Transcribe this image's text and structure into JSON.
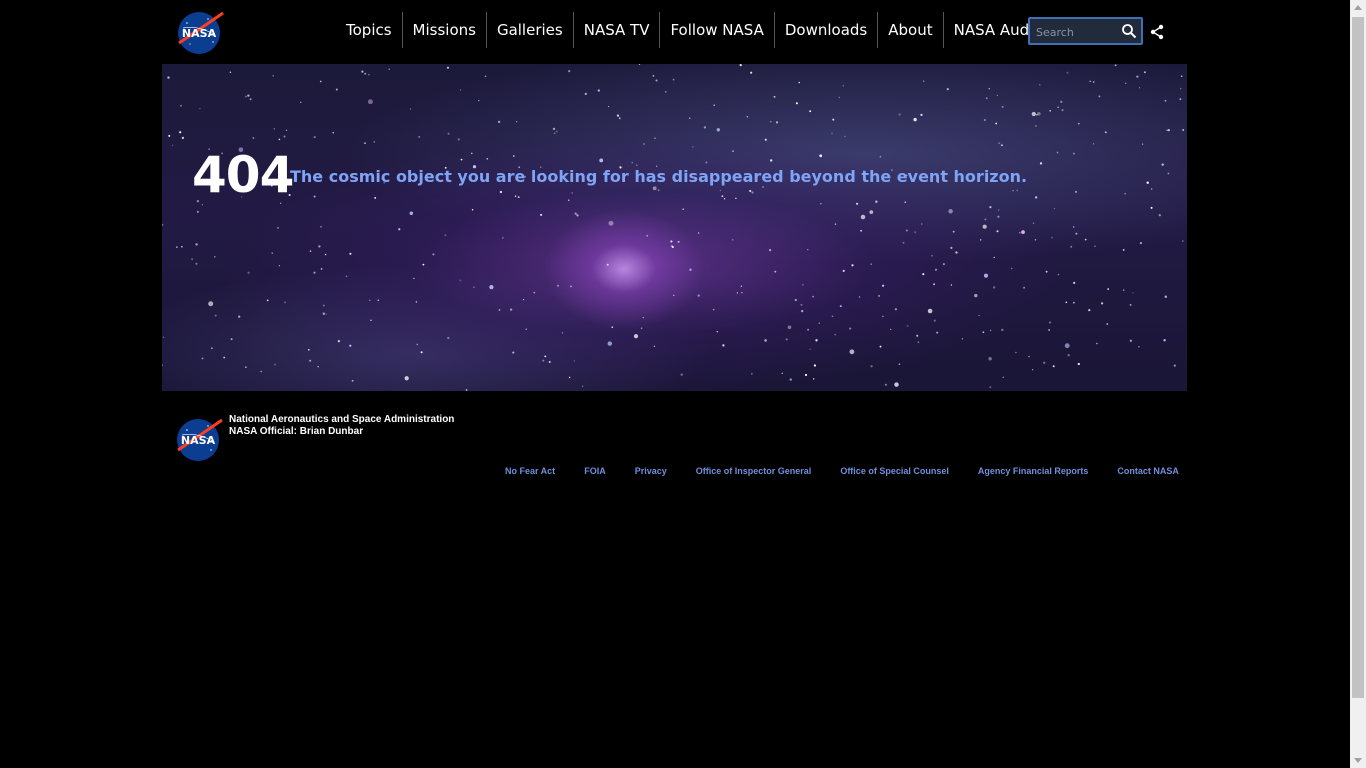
{
  "header": {
    "nav": [
      "Topics",
      "Missions",
      "Galleries",
      "NASA TV",
      "Follow NASA",
      "Downloads",
      "About",
      "NASA Audiences"
    ],
    "search_placeholder": "Search",
    "logo_text": "NASA"
  },
  "hero": {
    "code": "404",
    "message": "The cosmic object you are looking for has disappeared beyond the event horizon."
  },
  "footer": {
    "agency": "National Aeronautics and Space Administration",
    "official": "NASA Official: Brian Dunbar",
    "links": [
      "No Fear Act",
      "FOIA",
      "Privacy",
      "Office of Inspector General",
      "Office of Special Counsel",
      "Agency Financial Reports",
      "Contact NASA"
    ]
  },
  "colors": {
    "accent": "#7fa3f5",
    "link": "#6f8fdc",
    "background": "#000000",
    "nasa_blue": "#0b3d91",
    "nasa_red": "#fc3d21"
  },
  "icons": [
    "nasa-logo-icon",
    "search-icon",
    "share-icon"
  ]
}
